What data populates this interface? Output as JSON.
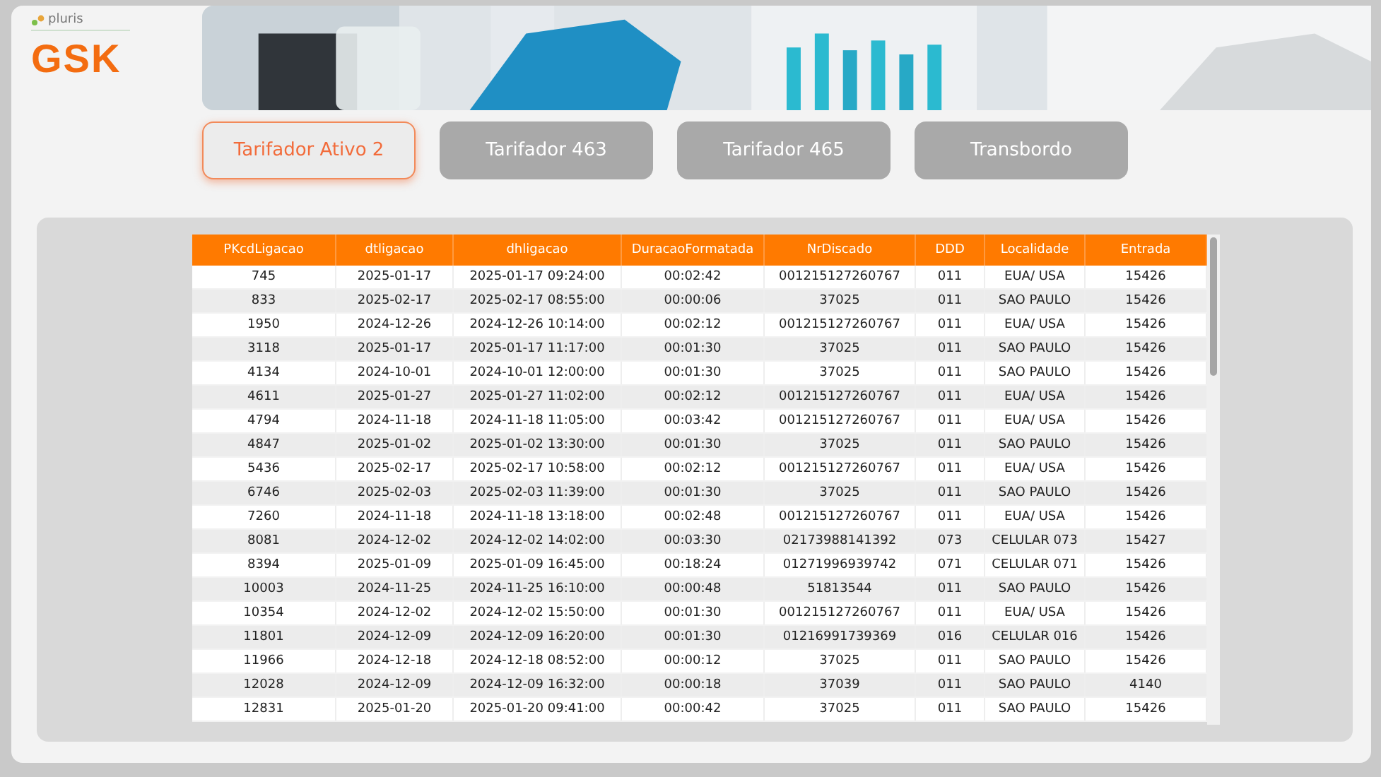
{
  "brand": {
    "partner": "pluris",
    "company": "GSK"
  },
  "tabs": [
    {
      "label": "Tarifador Ativo 2",
      "selected": true
    },
    {
      "label": "Tarifador 463",
      "selected": false
    },
    {
      "label": "Tarifador 465",
      "selected": false
    },
    {
      "label": "Transbordo",
      "selected": false
    }
  ],
  "table": {
    "columns": [
      "PKcdLigacao",
      "dtligacao",
      "dhligacao",
      "DuracaoFormatada",
      "NrDiscado",
      "DDD",
      "Localidade",
      "Entrada"
    ],
    "rows": [
      [
        "745",
        "2025-01-17",
        "2025-01-17 09:24:00",
        "00:02:42",
        "001215127260767",
        "011",
        "EUA/ USA",
        "15426"
      ],
      [
        "833",
        "2025-02-17",
        "2025-02-17 08:55:00",
        "00:00:06",
        "37025",
        "011",
        "SAO PAULO",
        "15426"
      ],
      [
        "1950",
        "2024-12-26",
        "2024-12-26 10:14:00",
        "00:02:12",
        "001215127260767",
        "011",
        "EUA/ USA",
        "15426"
      ],
      [
        "3118",
        "2025-01-17",
        "2025-01-17 11:17:00",
        "00:01:30",
        "37025",
        "011",
        "SAO PAULO",
        "15426"
      ],
      [
        "4134",
        "2024-10-01",
        "2024-10-01 12:00:00",
        "00:01:30",
        "37025",
        "011",
        "SAO PAULO",
        "15426"
      ],
      [
        "4611",
        "2025-01-27",
        "2025-01-27 11:02:00",
        "00:02:12",
        "001215127260767",
        "011",
        "EUA/ USA",
        "15426"
      ],
      [
        "4794",
        "2024-11-18",
        "2024-11-18 11:05:00",
        "00:03:42",
        "001215127260767",
        "011",
        "EUA/ USA",
        "15426"
      ],
      [
        "4847",
        "2025-01-02",
        "2025-01-02 13:30:00",
        "00:01:30",
        "37025",
        "011",
        "SAO PAULO",
        "15426"
      ],
      [
        "5436",
        "2025-02-17",
        "2025-02-17 10:58:00",
        "00:02:12",
        "001215127260767",
        "011",
        "EUA/ USA",
        "15426"
      ],
      [
        "6746",
        "2025-02-03",
        "2025-02-03 11:39:00",
        "00:01:30",
        "37025",
        "011",
        "SAO PAULO",
        "15426"
      ],
      [
        "7260",
        "2024-11-18",
        "2024-11-18 13:18:00",
        "00:02:48",
        "001215127260767",
        "011",
        "EUA/ USA",
        "15426"
      ],
      [
        "8081",
        "2024-12-02",
        "2024-12-02 14:02:00",
        "00:03:30",
        "02173988141392",
        "073",
        "CELULAR 073",
        "15427"
      ],
      [
        "8394",
        "2025-01-09",
        "2025-01-09 16:45:00",
        "00:18:24",
        "01271996939742",
        "071",
        "CELULAR 071",
        "15426"
      ],
      [
        "10003",
        "2024-11-25",
        "2024-11-25 16:10:00",
        "00:00:48",
        "51813544",
        "011",
        "SAO PAULO",
        "15426"
      ],
      [
        "10354",
        "2024-12-02",
        "2024-12-02 15:50:00",
        "00:01:30",
        "001215127260767",
        "011",
        "EUA/ USA",
        "15426"
      ],
      [
        "11801",
        "2024-12-09",
        "2024-12-09 16:20:00",
        "00:01:30",
        "01216991739369",
        "016",
        "CELULAR 016",
        "15426"
      ],
      [
        "11966",
        "2024-12-18",
        "2024-12-18 08:52:00",
        "00:00:12",
        "37025",
        "011",
        "SAO PAULO",
        "15426"
      ],
      [
        "12028",
        "2024-12-09",
        "2024-12-09 16:32:00",
        "00:00:18",
        "37039",
        "011",
        "SAO PAULO",
        "4140"
      ],
      [
        "12831",
        "2025-01-20",
        "2025-01-20 09:41:00",
        "00:00:42",
        "37025",
        "011",
        "SAO PAULO",
        "15426"
      ]
    ]
  }
}
